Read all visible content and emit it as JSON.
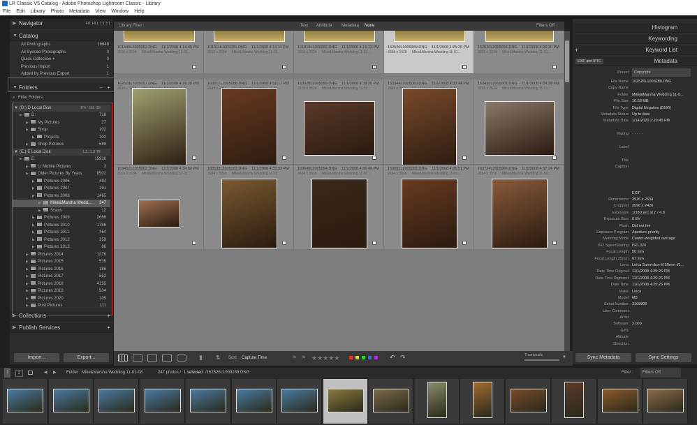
{
  "window_title": "LR Classic V5 Catalog - Adobe Photoshop Lightroom Classic - Library",
  "menu": [
    "File",
    "Edit",
    "Library",
    "Photo",
    "Metadata",
    "View",
    "Window",
    "Help"
  ],
  "left_panel": {
    "navigator": {
      "label": "Navigator",
      "zoom": [
        "FIT",
        "FILL",
        "1:1",
        "3:1"
      ]
    },
    "catalog": {
      "label": "Catalog",
      "items": [
        {
          "label": "All Photographs",
          "count": "16648"
        },
        {
          "label": "All Synced Photographs",
          "count": "0"
        },
        {
          "label": "Quick Collection +",
          "count": "0"
        },
        {
          "label": "Previous Import",
          "count": "1"
        },
        {
          "label": "Added by Previous Export",
          "count": "1"
        }
      ]
    },
    "folders": {
      "label": "Folders",
      "filter_label": "Filter Folders",
      "volumes": [
        {
          "name": "(D:) D Local Disk",
          "space": "374 / 366 GB",
          "items": [
            {
              "label": "D:",
              "count": "718",
              "indent": 0
            },
            {
              "label": "My Pictures",
              "count": "27",
              "indent": 1
            },
            {
              "label": "Shop",
              "count": "102",
              "indent": 1
            },
            {
              "label": "Projects",
              "count": "102",
              "indent": 2
            },
            {
              "label": "Shop Pictures",
              "count": "589",
              "indent": 1
            }
          ]
        },
        {
          "name": "(E:) E Local Disk",
          "space": "1.2 / 1.8 TB",
          "items": [
            {
              "label": "E:",
              "count": "15930",
              "indent": 0
            },
            {
              "label": "Lr Mobile Pictures",
              "count": "3",
              "indent": 1
            },
            {
              "label": "Older Pictures By Years",
              "count": "8502",
              "indent": 1
            },
            {
              "label": "Pictures 2006",
              "count": "494",
              "indent": 2
            },
            {
              "label": "Pictures 2007",
              "count": "191",
              "indent": 2
            },
            {
              "label": "Pictures 2008",
              "count": "1465",
              "indent": 2
            },
            {
              "label": "Mike&Marsha Wedd...",
              "count": "247",
              "indent": 3
            },
            {
              "label": "Scans",
              "count": "12",
              "indent": 3
            },
            {
              "label": "Pictures 2009",
              "count": "2666",
              "indent": 2
            },
            {
              "label": "Pictures 2010",
              "count": "1786",
              "indent": 2
            },
            {
              "label": "Pictures 2011",
              "count": "464",
              "indent": 2
            },
            {
              "label": "Pictures 2012",
              "count": "259",
              "indent": 2
            },
            {
              "label": "Pictures 2013",
              "count": "86",
              "indent": 2
            },
            {
              "label": "Pictures 2014",
              "count": "1276",
              "indent": 1
            },
            {
              "label": "Pictures 2015",
              "count": "535",
              "indent": 1
            },
            {
              "label": "Pictures 2016",
              "count": "186",
              "indent": 1
            },
            {
              "label": "Pictures 2017",
              "count": "552",
              "indent": 1
            },
            {
              "label": "Pictures 2018",
              "count": "4155",
              "indent": 1
            },
            {
              "label": "Pictures 2019",
              "count": "504",
              "indent": 1
            },
            {
              "label": "Pictures 2020",
              "count": "105",
              "indent": 1
            },
            {
              "label": "Post Pictures",
              "count": "111",
              "indent": 1
            }
          ]
        }
      ]
    },
    "collections": "Collections",
    "publish": "Publish Services",
    "import_btn": "Import...",
    "export_btn": "Export..."
  },
  "library_filter": {
    "label": "Library Filter :",
    "options": [
      "Text",
      "Attribute",
      "Metadata",
      "None"
    ],
    "filters": "Filters Off"
  },
  "grid": {
    "rows": [
      [
        {
          "fn": "161445L2005053.DNG",
          "date": "11/1/2008 4:14:45 PM",
          "dim": "3916 x 2634",
          "folder": "Mike&Marsha Wedding 11-01..."
        },
        {
          "fn": "161611L1009281.DNG",
          "date": "11/1/2008 4:16:11 PM",
          "dim": "3916 x 2634",
          "folder": "Mike&Marsha Wedding 11-01..."
        },
        {
          "fn": "161613L1009282.DNG",
          "date": "11/1/2008 4:16:13 PM",
          "dim": "3916 x 2634",
          "folder": "Mike&Marsha Wedding 11-01..."
        },
        {
          "fn": "162526L1009289.DNG",
          "date": "11/1/2008 4:25:26 PM",
          "dim": "3598 x 2420",
          "folder": "Mike&Marsha Wedding 11-01..."
        },
        {
          "fn": "162620L2005056.DNG",
          "date": "11/1/2008 4:26:20 PM",
          "dim": "3916 x 2634",
          "folder": "Mike&Marsha Wedding 11-01..."
        }
      ],
      [
        {
          "fn": "162628L2005057.DNG",
          "date": "11/1/2008 4:26:28 PM",
          "dim": "2634 x 3916",
          "folder": "Mike&Marsha Wedding 11-01..."
        },
        {
          "fn": "163217L2005058.DNG",
          "date": "11/1/2008 4:32:17 PM",
          "dim": "2634 x 3916",
          "folder": "Mike&Marsha Wedding 11-01..."
        },
        {
          "fn": "163328L2005059.DNG",
          "date": "11/1/2008 4:33:28 PM",
          "dim": "3916 x 2634",
          "folder": "Mike&Marsha Wedding 11-01..."
        },
        {
          "fn": "163344L2005060.DNG",
          "date": "11/1/2008 4:33:44 PM",
          "dim": "2634 x 3916",
          "folder": "Mike&Marsha Wedding 11-01..."
        },
        {
          "fn": "163438L2005061.DNG",
          "date": "11/1/2008 4:34:38 PM",
          "dim": "3916 x 2634",
          "folder": "Mike&Marsha Wedding 11-01..."
        }
      ],
      [
        {
          "fn": "163452L2005062.DNG",
          "date": "11/1/2008 4:34:52 PM",
          "dim": "3916 x 2634",
          "folder": "Mike&Marsha Wedding 11-01..."
        },
        {
          "fn": "163533L2005063.DNG",
          "date": "11/1/2008 4:35:33 PM",
          "dim": "2634 x 3916",
          "folder": "Mike&Marsha Wedding 11-01..."
        },
        {
          "fn": "163648L2005064.DNG",
          "date": "11/1/2008 4:36:48 PM",
          "dim": "2634 x 3916",
          "folder": "Mike&Marsha Wedding 11-01..."
        },
        {
          "fn": "163651L2005065.DNG",
          "date": "11/1/2008 4:36:51 PM",
          "dim": "2634 x 3916",
          "folder": "Mike&Marsha Wedding 11-01..."
        },
        {
          "fn": "163724L2005066.DNG",
          "date": "11/1/2008 4:37:24 PM",
          "dim": "2634 x 3916",
          "folder": "Mike&Marsha Wedding 11-01..."
        }
      ]
    ]
  },
  "toolbar": {
    "sort_label": "Sort:",
    "sort_value": "Capture Time",
    "thumbnails_label": "Thumbnails"
  },
  "right_panel": {
    "histogram": "Histogram",
    "keywording": "Keywording",
    "keyword_list": "Keyword List",
    "metadata": "Metadata",
    "exif_select": "EXIF and IPTC",
    "preset_label": "Preset",
    "preset_value": "Copyright",
    "rows": [
      [
        "File Name",
        "162526L1009289.DNG"
      ],
      [
        "Copy Name",
        ""
      ],
      [
        "Folder",
        "Mike&Marsha Wedding 11-0..."
      ],
      [
        "File Size",
        "10.09 MB"
      ],
      [
        "File Type",
        "Digital Negative (DNG)"
      ],
      [
        "Metadata Status",
        "Up to date"
      ],
      [
        "Metadata Date",
        "1/14/2020 2:20:45 PM"
      ],
      [
        "",
        ""
      ],
      [
        "Rating",
        "· · · · ·"
      ],
      [
        "",
        ""
      ],
      [
        "Label",
        ""
      ],
      [
        "",
        ""
      ],
      [
        "Title",
        ""
      ],
      [
        "Caption",
        ""
      ],
      [
        "",
        ""
      ],
      [
        "",
        ""
      ],
      [
        "",
        ""
      ],
      [
        "",
        "EXIF"
      ],
      [
        "Dimensions",
        "3916 x 2634"
      ],
      [
        "Cropped",
        "3598 x 2420"
      ],
      [
        "Exposure",
        "1/180 sec at ƒ / 4.8"
      ],
      [
        "Exposure Bias",
        "0 EV"
      ],
      [
        "Flash",
        "Did not fire"
      ],
      [
        "Exposure Program",
        "Aperture priority"
      ],
      [
        "Metering Mode",
        "Center-weighted average"
      ],
      [
        "ISO Speed Rating",
        "ISO 320"
      ],
      [
        "Focal Length",
        "50 mm"
      ],
      [
        "Focal Length 35mm",
        "67 mm"
      ],
      [
        "Lens",
        "Leica Summilux-M 50mm f/1..."
      ],
      [
        "Date Time Original",
        "11/1/2008 4:25:26 PM"
      ],
      [
        "Date Time Digitized",
        "11/1/2008 4:25:26 PM"
      ],
      [
        "Date Time",
        "11/1/2008 4:25:26 PM"
      ],
      [
        "Make",
        "Leica"
      ],
      [
        "Model",
        "M8"
      ],
      [
        "Serial Number",
        "3108806"
      ],
      [
        "User Comment",
        ""
      ],
      [
        "Artist",
        ""
      ],
      [
        "Software",
        "2.000"
      ],
      [
        "GPS",
        ""
      ],
      [
        "Altitude",
        ""
      ],
      [
        "Direction",
        ""
      ]
    ],
    "sync_metadata": "Sync Metadata",
    "sync_settings": "Sync Settings"
  },
  "filmstrip": {
    "pages": [
      "1",
      "2"
    ],
    "path_label": "Folder : Mike&Marsha Wedding 11-01-08",
    "count_label": "247 photos /",
    "selected_label": "1 selected",
    "selected_file": "/162526L1009289.DNG",
    "filter_label": "Filter :",
    "filter_value": "Filters Off"
  }
}
